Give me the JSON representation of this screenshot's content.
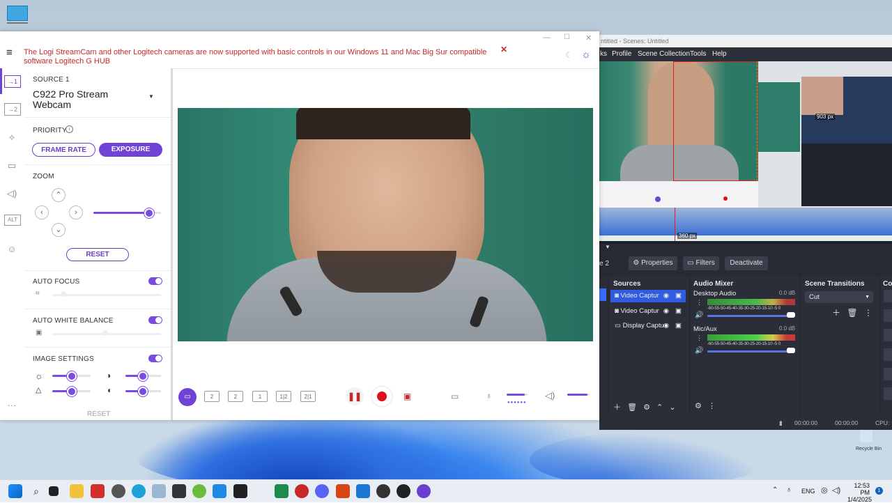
{
  "desktop": {
    "top_icon_label": "\u0000",
    "recycle_bin_label": "Recycle Bin"
  },
  "logi": {
    "banner": "The Logi StreamCam and other Logitech cameras are now supported with basic controls in our Windows 11 and Mac Big Sur compatible software Logitech G HUB",
    "source_label": "SOURCE 1",
    "camera_name": "C922 Pro Stream Webcam",
    "priority_label": "PRIORITY",
    "frame_rate_label": "FRAME RATE",
    "exposure_label": "EXPOSURE",
    "zoom_label": "ZOOM",
    "zoom_level": 0.82,
    "reset_label": "RESET",
    "auto_focus_label": "AUTO FOCUS",
    "auto_white_balance_label": "AUTO WHITE BALANCE",
    "image_settings_label": "IMAGE SETTINGS",
    "reset_disabled_label": "RESET",
    "nav_alt_label": "ALT",
    "accent": "#7043d6",
    "banner_color": "#c62828"
  },
  "obs": {
    "title": "ntitled - Scenes: Untitled",
    "menu": [
      "ks",
      "Profile",
      "Scene Collection",
      "Tools",
      "Help"
    ],
    "canvas_label_top": "903 px",
    "canvas_label_bottom": "360 px",
    "scene_tab": "e 2",
    "properties_label": "Properties",
    "filters_label": "Filters",
    "deactivate_label": "Deactivate",
    "sources_header": "Sources",
    "sources": [
      "Video Captur",
      "Video Captur",
      "Display Captu"
    ],
    "mixer_header": "Audio Mixer",
    "desktop_audio_label": "Desktop Audio",
    "desktop_audio_db": "0.0 dB",
    "mic_label": "Mic/Aux",
    "mic_db": "0.0 dB",
    "meter_scale": "-60-55-50-45-40-35-30-25-20-15-10 -5 0",
    "transitions_header": "Scene Transitions",
    "transition_value": "Cut",
    "controls_header": "Co",
    "status_time1": "00:00:00",
    "status_time2": "00:00:00",
    "status_cpu": "CPU:"
  },
  "taskbar": {
    "lang": "ENG",
    "time": "12:53 PM",
    "date": "1/4/2025"
  }
}
